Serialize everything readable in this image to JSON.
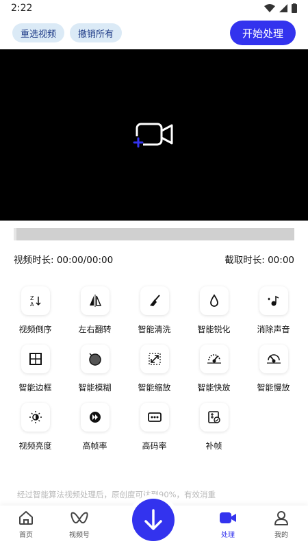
{
  "status_bar": {
    "time": "2:22"
  },
  "toolbar": {
    "reselect_label": "重选视频",
    "undo_all_label": "撤销所有",
    "start_label": "开始处理"
  },
  "info": {
    "video_duration": "视频时长: 00:00/00:00",
    "clip_duration": "截取时长: 00:00"
  },
  "features": [
    {
      "label": "视频倒序",
      "icon": "reverse-sort-icon"
    },
    {
      "label": "左右翻转",
      "icon": "flip-horizontal-icon"
    },
    {
      "label": "智能清洗",
      "icon": "broom-icon"
    },
    {
      "label": "智能锐化",
      "icon": "droplet-icon"
    },
    {
      "label": "消除声音",
      "icon": "mute-note-icon"
    },
    {
      "label": "智能边框",
      "icon": "border-grid-icon"
    },
    {
      "label": "智能模糊",
      "icon": "blur-ball-icon"
    },
    {
      "label": "智能缩放",
      "icon": "scale-arrows-icon"
    },
    {
      "label": "智能快放",
      "icon": "fast-speedometer-icon"
    },
    {
      "label": "智能慢放",
      "icon": "slow-speedometer-icon"
    },
    {
      "label": "视频亮度",
      "icon": "brightness-icon"
    },
    {
      "label": "高帧率",
      "icon": "fast-forward-icon"
    },
    {
      "label": "高码率",
      "icon": "dots-box-icon"
    },
    {
      "label": "补帧",
      "icon": "frame-fill-icon"
    }
  ],
  "footer_text": "经过智能算法视频处理后，原创度可达到90%，有效消重",
  "nav": {
    "home": "首页",
    "channels": "视频号",
    "process": "处理",
    "mine": "我的"
  },
  "colors": {
    "accent": "#3333ee",
    "pill_bg": "#dbeaf6",
    "video_bg": "#000000"
  }
}
